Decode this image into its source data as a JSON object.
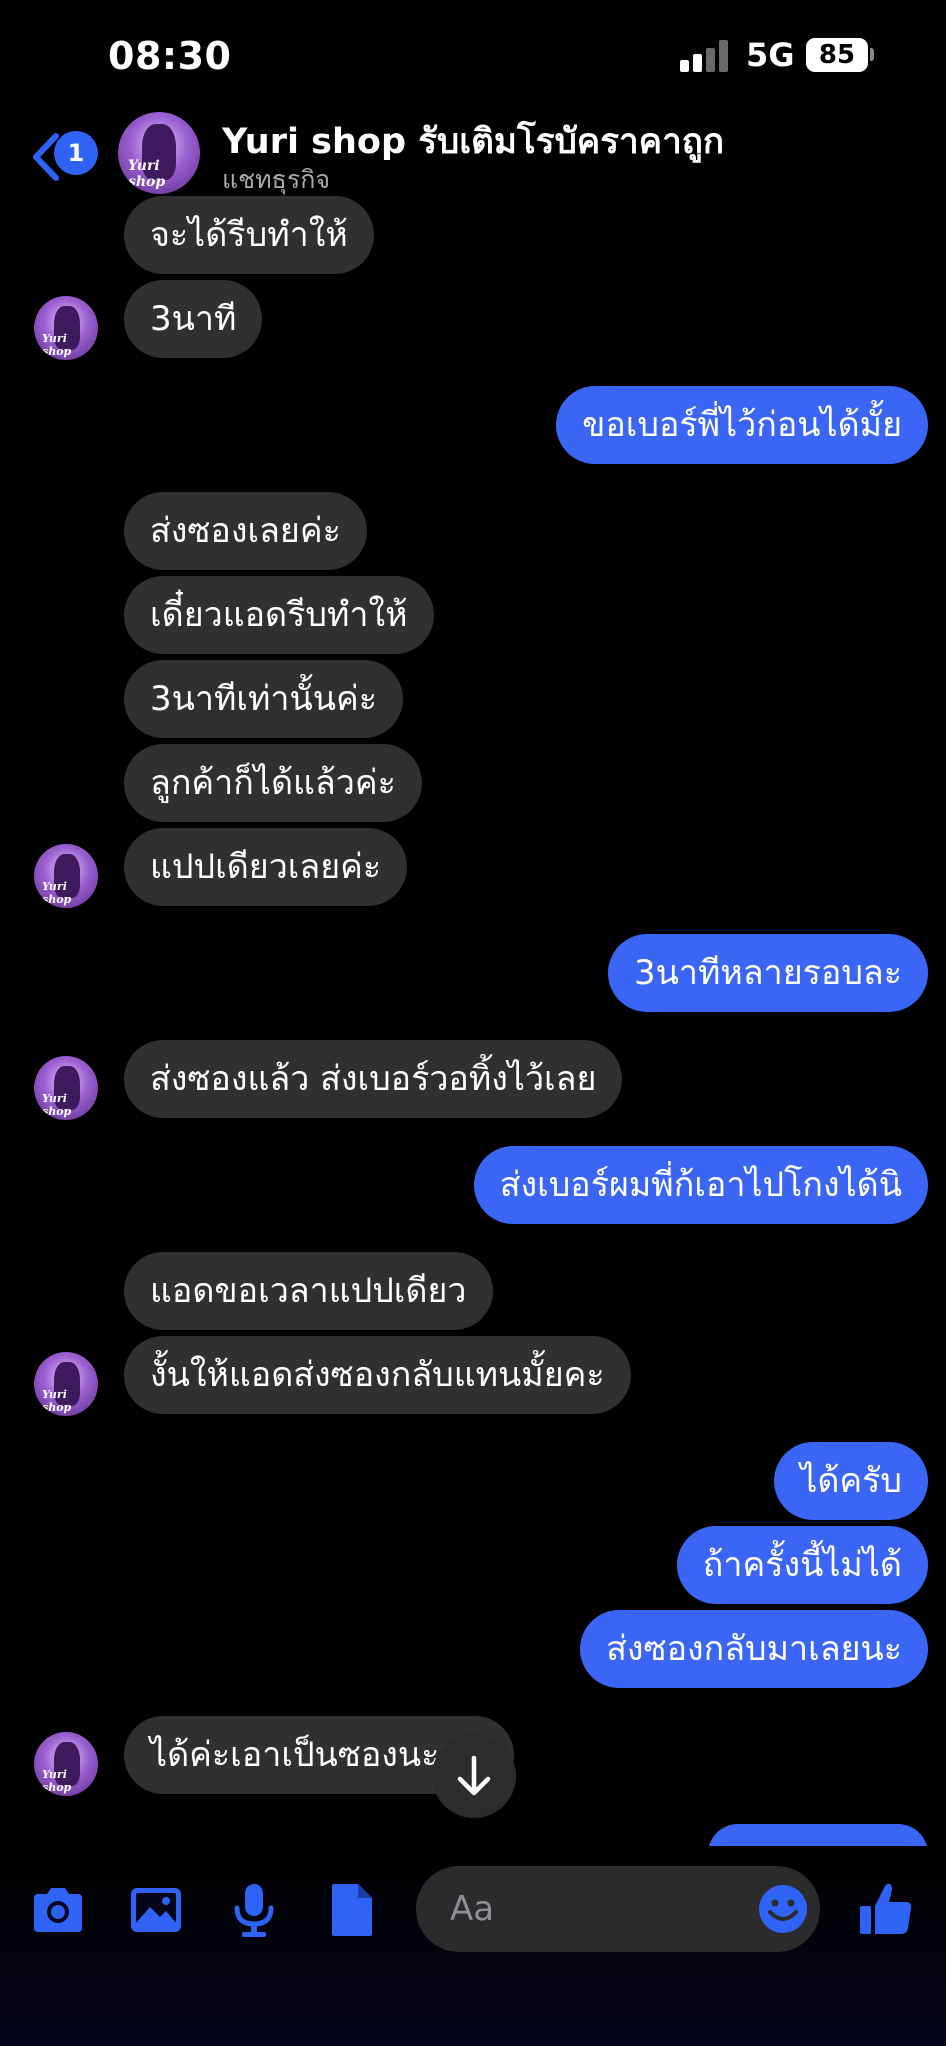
{
  "status_bar": {
    "time": "08:30",
    "network": "5G",
    "battery": "85"
  },
  "header": {
    "back_badge": "1",
    "title": "Yuri shop รับเติมโรบัคราคาถูก",
    "subtitle": "แชทธุรกิจ",
    "avatar_logo": "Yuri shop"
  },
  "messages": [
    {
      "side": "in",
      "text": "จะได้รีบทำให้"
    },
    {
      "side": "in",
      "text": "3นาที"
    },
    {
      "side": "out",
      "text": "ขอเบอร์พี่ไว้ก่อนได้มั้ย"
    },
    {
      "side": "in",
      "text": "ส่งซองเลยค่ะ"
    },
    {
      "side": "in",
      "text": "เดี๋ยวแอดรีบทำให้"
    },
    {
      "side": "in",
      "text": "3นาทีเท่านั้นค่ะ"
    },
    {
      "side": "in",
      "text": "ลูกค้าก็ได้แล้วค่ะ"
    },
    {
      "side": "in",
      "text": "แปปเดียวเลยค่ะ"
    },
    {
      "side": "out",
      "text": "3นาทีหลายรอบละ"
    },
    {
      "side": "in",
      "text": "ส่งซองแล้ว ส่งเบอร์วอทิ้งไว้เลย"
    },
    {
      "side": "out",
      "text": "ส่งเบอร์ผมพี่ก้เอาไปโกงได้นิ"
    },
    {
      "side": "in",
      "text": "แอดขอเวลาแปปเดียว"
    },
    {
      "side": "in",
      "text": "งั้นให้แอดส่งซองกลับแทนมั้ยคะ"
    },
    {
      "side": "out",
      "text": "ได้ครับ"
    },
    {
      "side": "out",
      "text": "ถ้าครั้งนี้ไม่ได้"
    },
    {
      "side": "out",
      "text": "ส่งซองกลับมาเลยนะ"
    },
    {
      "side": "in",
      "text": "ได้ค่ะเอาเป็นซองนะ"
    }
  ],
  "composer": {
    "placeholder": "Aa",
    "icons": [
      "camera-icon",
      "image-icon",
      "microphone-icon",
      "file-icon",
      "emoji-icon",
      "thumbs-up-icon"
    ]
  },
  "colors": {
    "outgoing_bubble": "#3b66f5",
    "incoming_bubble": "#303030",
    "accent": "#2e63f6"
  }
}
